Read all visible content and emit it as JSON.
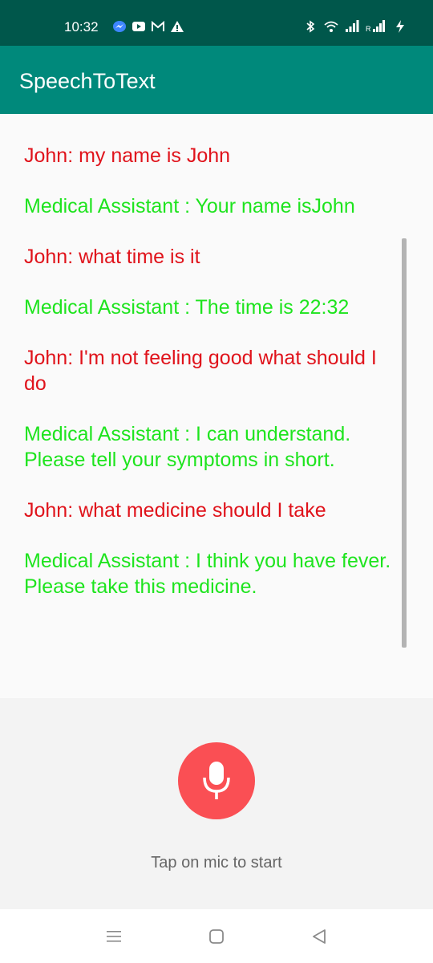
{
  "status_bar": {
    "time": "10:32",
    "left_icons": [
      "messenger-icon",
      "youtube-icon",
      "gmail-icon",
      "warning-icon"
    ],
    "right_icons": [
      "bluetooth-icon",
      "wifi-icon",
      "signal-icon",
      "signal-roaming-icon",
      "battery-charging-icon"
    ]
  },
  "app_bar": {
    "title": "SpeechToText",
    "color": "#00897b"
  },
  "conversation": {
    "messages": [
      {
        "speaker": "user",
        "text": "John: my name is John"
      },
      {
        "speaker": "assistant",
        "text": "Medical Assistant : Your name isJohn"
      },
      {
        "speaker": "user",
        "text": "John: what time is it"
      },
      {
        "speaker": "assistant",
        "text": "Medical Assistant : The time is 22:32"
      },
      {
        "speaker": "user",
        "text": "John: I'm not feeling good what should I do"
      },
      {
        "speaker": "assistant",
        "text": "Medical Assistant : I can understand. Please tell your symptoms in short."
      },
      {
        "speaker": "user",
        "text": "John: what medicine should I take"
      },
      {
        "speaker": "assistant",
        "text": "Medical Assistant : I think you have fever. Please take this medicine."
      }
    ],
    "user_color": "#e0131b",
    "assistant_color": "#1ee41e"
  },
  "mic": {
    "icon": "mic-icon",
    "hint": "Tap on mic to start",
    "color": "#fa4f54"
  },
  "nav_bar": {
    "buttons": [
      "menu-icon",
      "home-icon",
      "back-icon"
    ]
  }
}
